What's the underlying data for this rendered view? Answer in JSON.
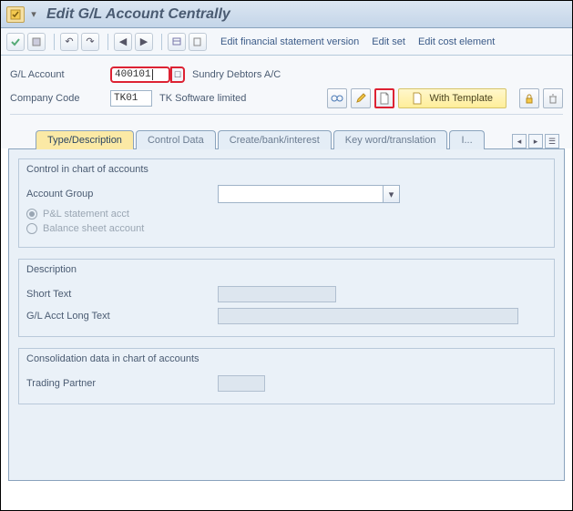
{
  "window": {
    "title": "Edit G/L Account Centrally"
  },
  "toolbar": {
    "links": {
      "edit_fsv": "Edit financial statement version",
      "edit_set": "Edit set",
      "edit_cost": "Edit cost element"
    }
  },
  "header": {
    "gl_account_label": "G/L Account",
    "gl_account_value": "400101",
    "gl_account_desc": "Sundry Debtors A/C",
    "company_code_label": "Company Code",
    "company_code_value": "TK01",
    "company_code_desc": "TK Software limited",
    "with_template": "With Template"
  },
  "tabs": {
    "type_desc": "Type/Description",
    "control_data": "Control Data",
    "create_bank": "Create/bank/interest",
    "keyword": "Key word/translation",
    "info": "I..."
  },
  "panel": {
    "control_title": "Control in chart of accounts",
    "account_group_label": "Account Group",
    "pl_stmt": "P&L statement acct",
    "bs_acct": "Balance sheet account",
    "desc_title": "Description",
    "short_text": "Short Text",
    "long_text": "G/L Acct Long Text",
    "consol_title": "Consolidation data in chart of accounts",
    "trading_partner": "Trading Partner"
  }
}
